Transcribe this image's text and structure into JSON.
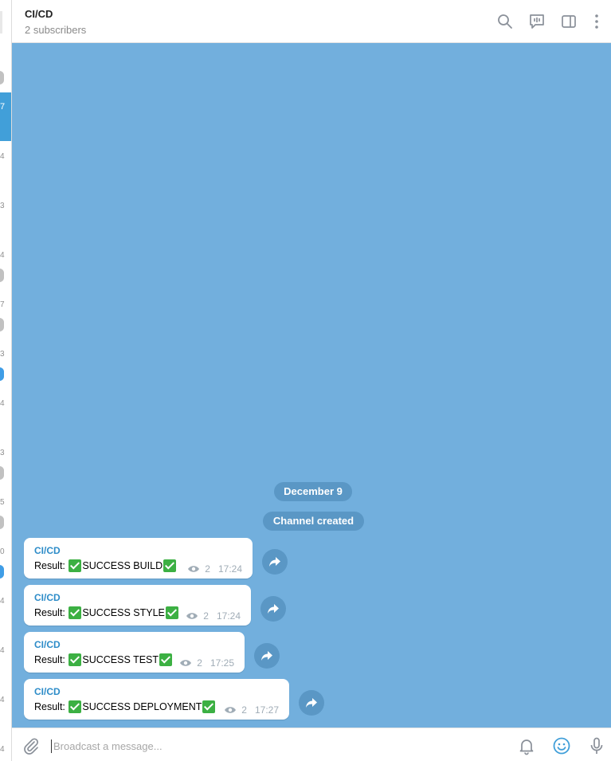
{
  "left_strip": {
    "active_number": "7",
    "numbers": [
      "4",
      "3",
      "4",
      "7",
      "3",
      "4",
      "3",
      "5",
      "0",
      "4",
      "4",
      "4",
      "4"
    ]
  },
  "header": {
    "title": "CI/CD",
    "subtitle": "2 subscribers",
    "icons": [
      "search-icon",
      "discussion-icon",
      "sidebar-toggle-icon",
      "more-icon"
    ]
  },
  "chat": {
    "service_date": "December 9",
    "service_created": "Channel created",
    "messages": [
      {
        "author": "CI/CD",
        "prefix": "Result: ",
        "status": "SUCCESS BUILD",
        "views": "2",
        "time": "17:24"
      },
      {
        "author": "CI/CD",
        "prefix": "Result: ",
        "status": "SUCCESS STYLE",
        "views": "2",
        "time": "17:24"
      },
      {
        "author": "CI/CD",
        "prefix": "Result: ",
        "status": "SUCCESS TEST",
        "views": "2",
        "time": "17:25"
      },
      {
        "author": "CI/CD",
        "prefix": "Result: ",
        "status": "SUCCESS DEPLOYMENT",
        "views": "2",
        "time": "17:27"
      }
    ]
  },
  "input": {
    "placeholder": "Broadcast a message...",
    "value": "",
    "icons": [
      "attach-icon",
      "bell-icon",
      "emoji-icon",
      "microphone-icon"
    ]
  },
  "colors": {
    "chat_background": "#72afdd",
    "service_bubble": "#5a97c5",
    "author": "#2d8cc8",
    "accent": "#419fd9",
    "check_emoji": "#3cb043"
  }
}
